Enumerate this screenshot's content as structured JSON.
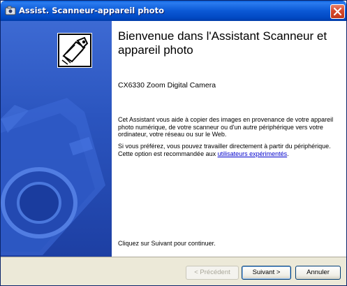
{
  "window": {
    "title": "Assist. Scanneur-appareil photo",
    "title_color": "#ffffff",
    "titlebar_color": "#0b59d5",
    "sidepanel_color": "#2b55bf"
  },
  "content": {
    "heading": "Bienvenue dans l'Assistant Scanneur et appareil photo",
    "device_name": "CX6330 Zoom Digital Camera",
    "paragraph1": "Cet Assistant vous aide à copier des images en provenance de votre appareil photo numérique, de votre scanneur ou d'un autre périphérique vers votre ordinateur, votre réseau ou sur le Web.",
    "paragraph2_text": "Si vous préférez, vous pouvez travailler directement à partir du périphérique. Cette option est recommandée aux ",
    "paragraph2_link": "utilisateurs expérimentés",
    "paragraph2_end": ".",
    "continue_text": "Cliquez sur Suivant pour continuer."
  },
  "footer": {
    "back_label": "< Précédent",
    "next_label": "Suivant >",
    "cancel_label": "Annuler"
  },
  "icons": {
    "title": "camera-icon",
    "close": "close-icon",
    "wizard": "scanner-camera-icon",
    "watermark": "camera-watermark-icon"
  }
}
